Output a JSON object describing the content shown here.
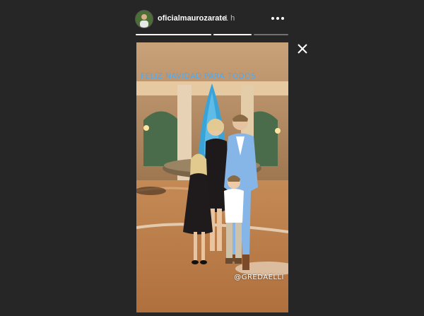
{
  "story": {
    "username": "oficialmaurozarate",
    "timestamp": "1 h",
    "caption": "FELIZ NAVIDAD PARA TODOS",
    "mention": "@GREDAELLI",
    "progress_segments": [
      1.0,
      1.0,
      0.0
    ]
  },
  "icons": {
    "more": "more-options-icon",
    "close": "close-icon",
    "avatar": "profile-avatar"
  },
  "colors": {
    "background": "#262626",
    "caption": "#57a7e8",
    "text": "#ffffff",
    "muted": "#bdbdbd"
  }
}
